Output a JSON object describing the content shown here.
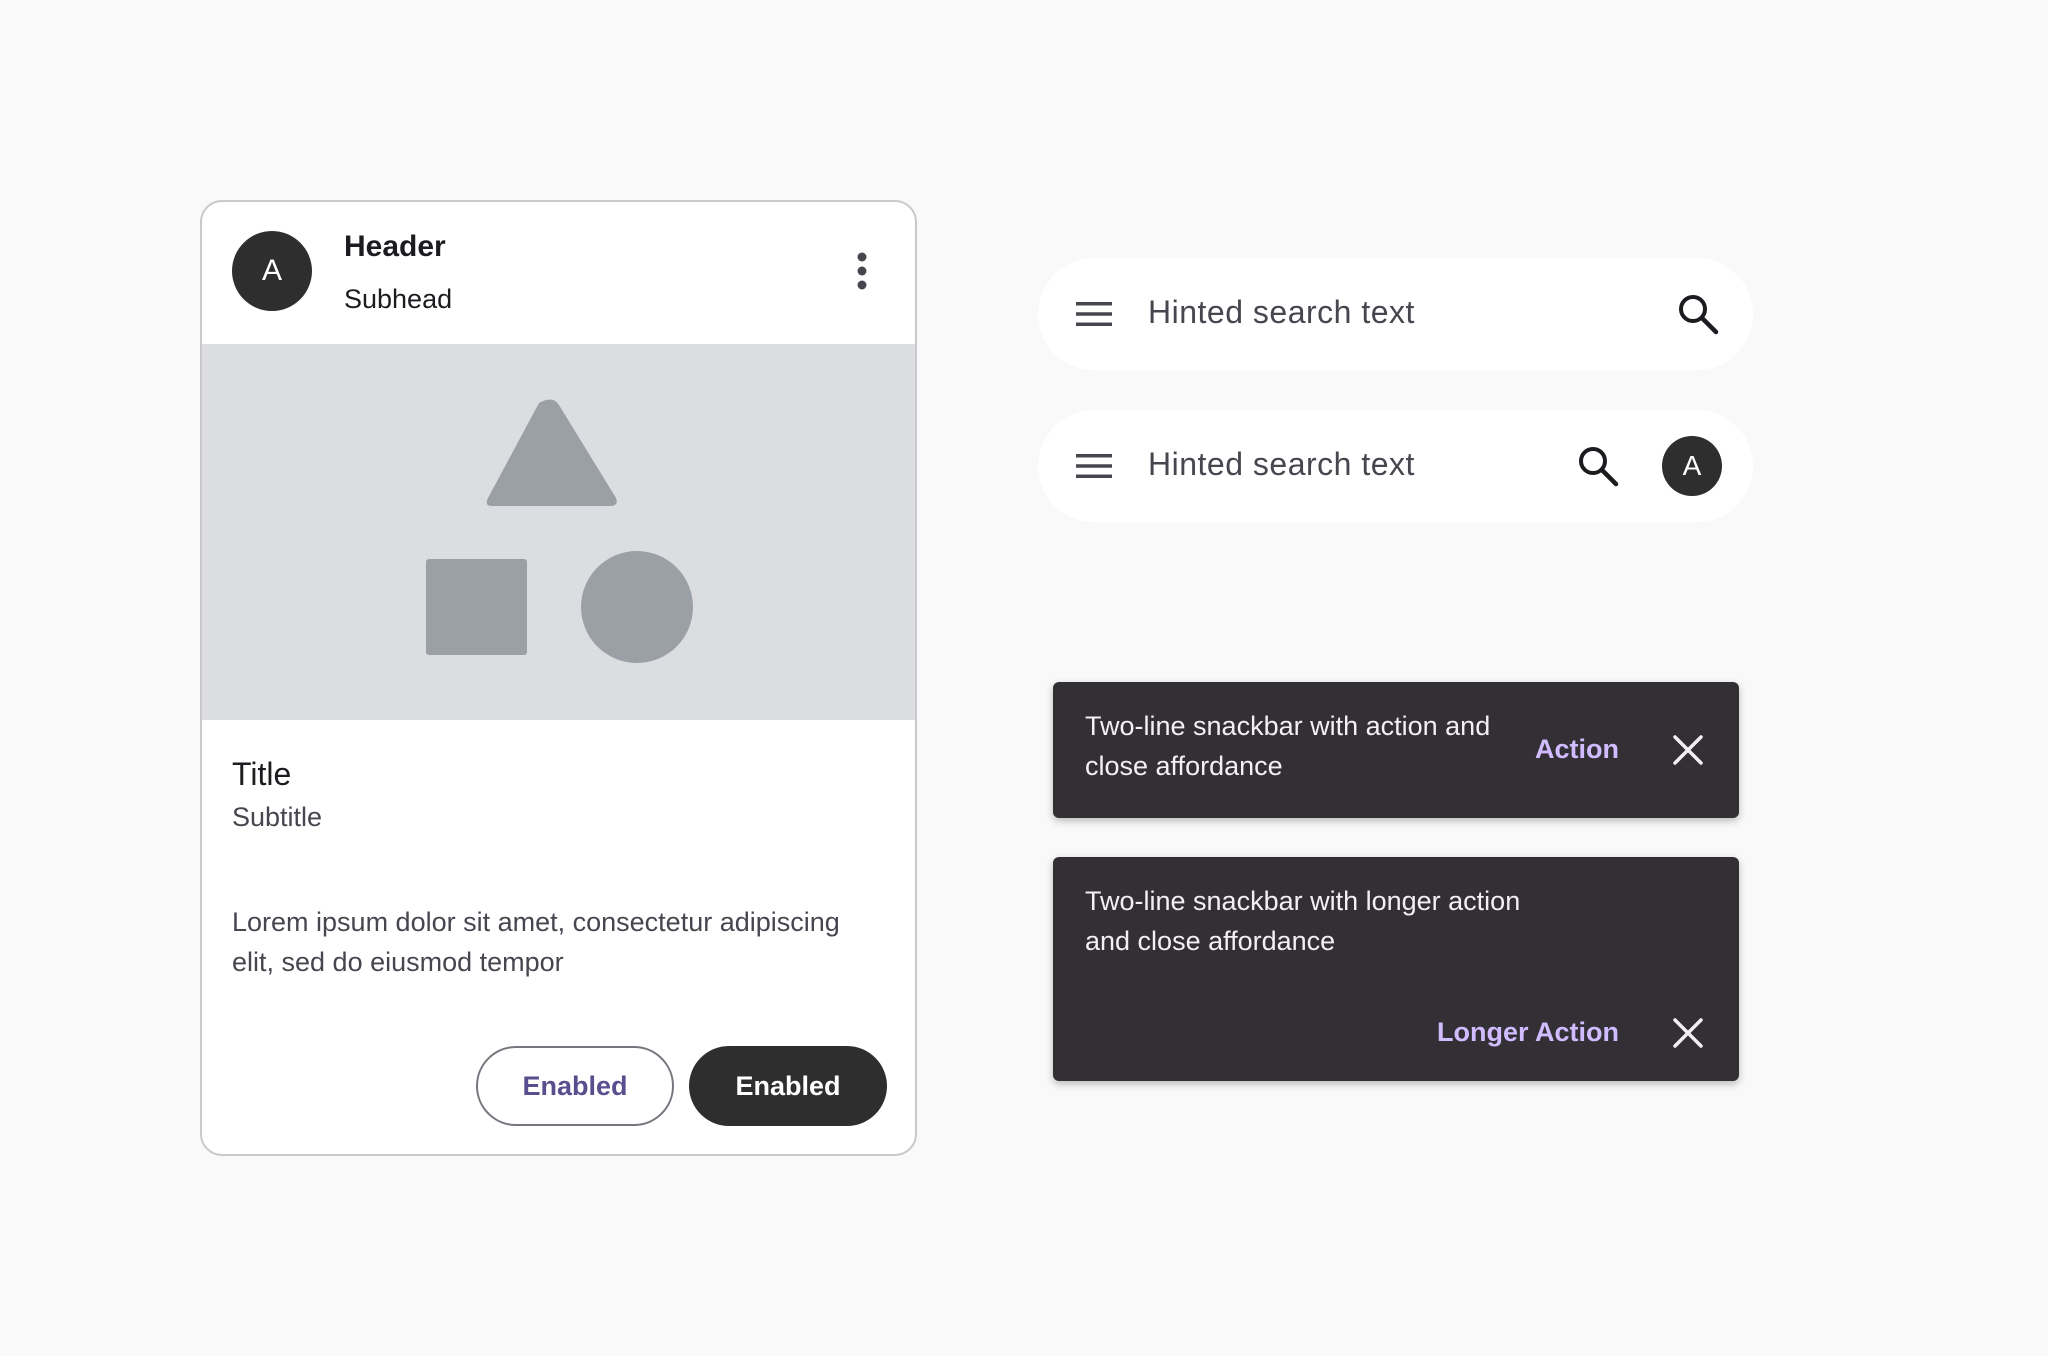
{
  "card": {
    "avatar_letter": "A",
    "header": "Header",
    "subhead": "Subhead",
    "title": "Title",
    "subtitle": "Subtitle",
    "body": "Lorem ipsum dolor sit amet, consectetur adipiscing elit, sed do eiusmod tempor",
    "outlined_button": "Enabled",
    "filled_button": "Enabled",
    "more_icon": "more-vert-icon",
    "media_icons": [
      "triangle-shape",
      "square-shape",
      "circle-shape"
    ]
  },
  "search_bars": [
    {
      "hint": "Hinted search text",
      "leading_icon": "menu-icon",
      "trailing_icon": "search-icon"
    },
    {
      "hint": "Hinted search text",
      "leading_icon": "menu-icon",
      "trailing_icon": "search-icon",
      "avatar_letter": "A"
    }
  ],
  "snackbars": [
    {
      "text": "Two-line snackbar with action and close affordance",
      "action": "Action",
      "close_icon": "close-icon"
    },
    {
      "text": "Two-line snackbar with longer action and close affordance",
      "action": "Longer Action",
      "close_icon": "close-icon"
    }
  ],
  "colors": {
    "background": "#f9f9f9",
    "card_surface": "#ffffff",
    "media_placeholder": "#dcdde0",
    "media_shapes": "#9aa0a6",
    "dark_fill": "#2e2e2e",
    "snackbar_surface": "#322f35",
    "snackbar_action": "#d0bcff",
    "outlined_button_text": "#5b4e8f"
  }
}
